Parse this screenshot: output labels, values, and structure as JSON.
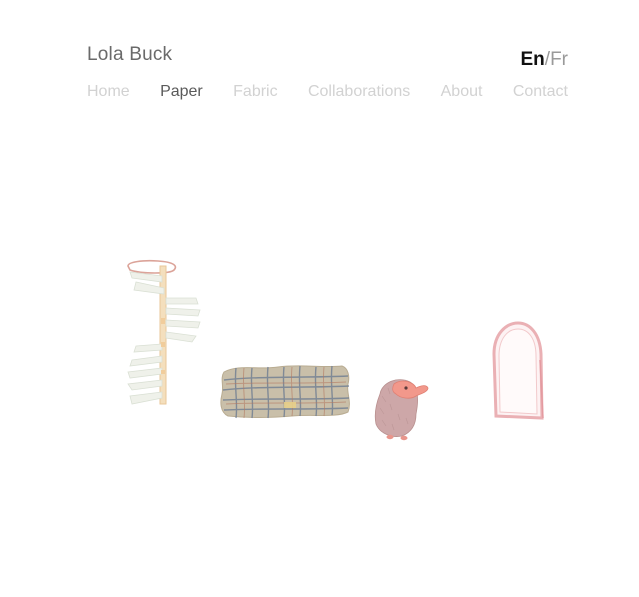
{
  "site": {
    "title": "Lola Buck"
  },
  "language": {
    "en": "En",
    "separator": "/",
    "fr": "Fr",
    "active": "En"
  },
  "nav": {
    "items": [
      {
        "label": "Home",
        "active": false
      },
      {
        "label": "Paper",
        "active": true
      },
      {
        "label": "Fabric",
        "active": false
      },
      {
        "label": "Collaborations",
        "active": false
      },
      {
        "label": "About",
        "active": false
      },
      {
        "label": "Contact",
        "active": false
      }
    ]
  },
  "gallery": {
    "items": [
      {
        "icon": "spiral-staircase-illustration"
      },
      {
        "icon": "woven-cushion-illustration"
      },
      {
        "icon": "hedgehog-illustration"
      },
      {
        "icon": "arched-mirror-illustration"
      }
    ]
  },
  "colors": {
    "text_title": "#6a6a6a",
    "nav_inactive": "#d2d2d2",
    "nav_active": "#5a5a5a",
    "lang_active": "#111111"
  }
}
